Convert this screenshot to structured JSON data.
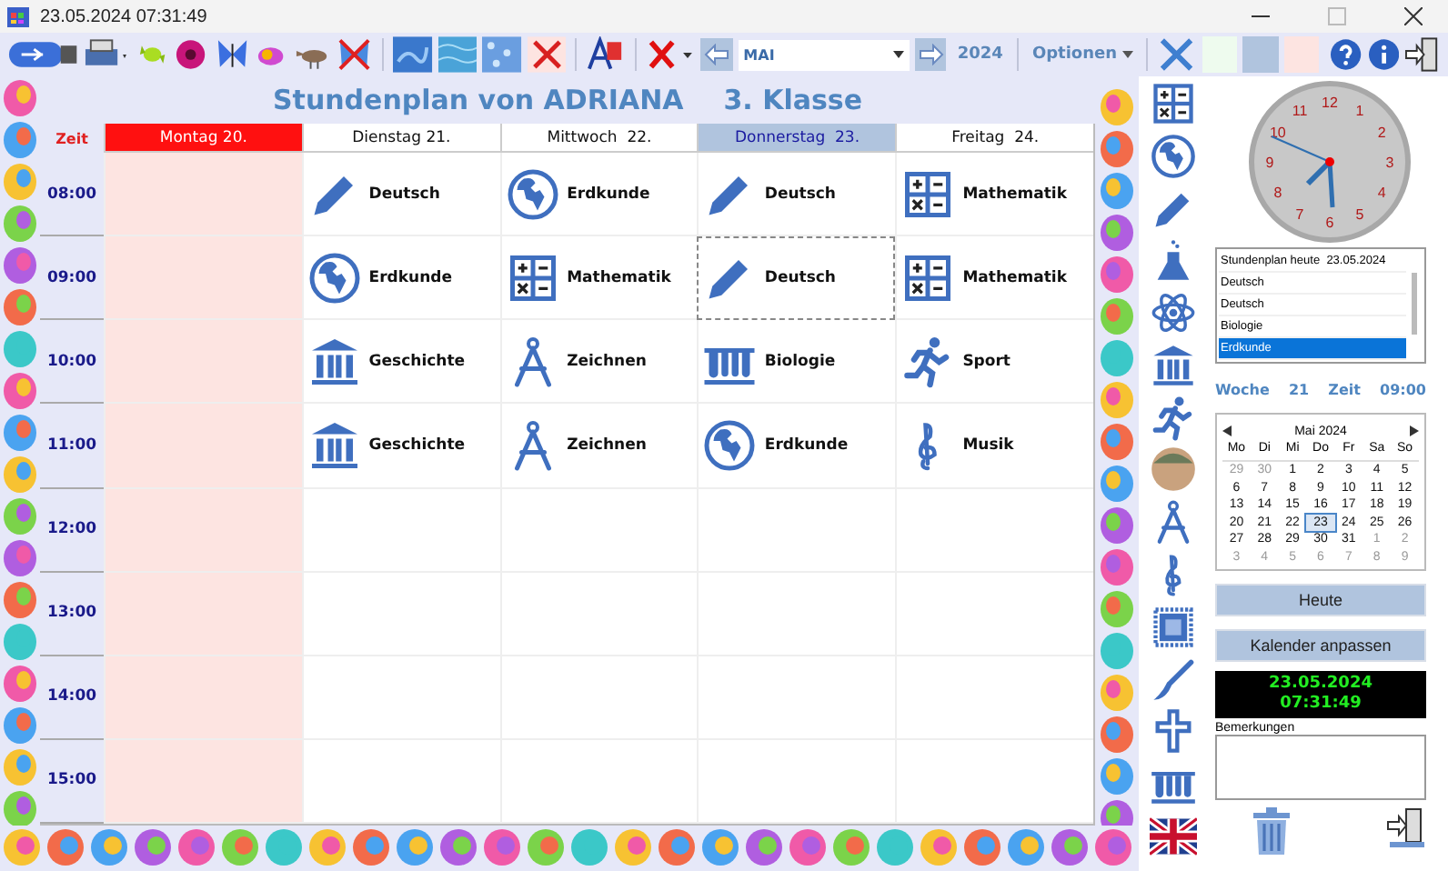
{
  "window": {
    "title": "23.05.2024 07:31:49"
  },
  "toolbar": {
    "month": "MAI",
    "year": "2024",
    "menu": "Optionen",
    "swatches": [
      {
        "color": "#eefbee"
      },
      {
        "color": "#b0c4de"
      },
      {
        "color": "#fde4e1"
      }
    ]
  },
  "timetable": {
    "title": "Stundenplan von ADRIANA",
    "class": "3. Klasse",
    "time_header": "Zeit",
    "days": [
      {
        "label": "Montag 20.",
        "holiday": true,
        "selected": false
      },
      {
        "label": "Dienstag 21.",
        "holiday": false,
        "selected": false
      },
      {
        "label": "Mittwoch  22.",
        "holiday": false,
        "selected": false
      },
      {
        "label": "Donnerstag  23.",
        "holiday": false,
        "selected": true
      },
      {
        "label": "Freitag  24.",
        "holiday": false,
        "selected": false
      }
    ],
    "rows": [
      {
        "time": "08:00",
        "cells": [
          {
            "focused": false
          },
          {
            "subject": "Deutsch",
            "kind": "pencil",
            "focused": false
          },
          {
            "subject": "Erdkunde",
            "kind": "globe",
            "focused": false
          },
          {
            "subject": "Deutsch",
            "kind": "pencil",
            "focused": false
          },
          {
            "subject": "Mathematik",
            "kind": "calculator",
            "focused": false
          }
        ]
      },
      {
        "time": "09:00",
        "cells": [
          {
            "focused": false
          },
          {
            "subject": "Erdkunde",
            "kind": "globe",
            "focused": false
          },
          {
            "subject": "Mathematik",
            "kind": "calculator",
            "focused": false
          },
          {
            "subject": "Deutsch",
            "kind": "pencil",
            "focused": true
          },
          {
            "subject": "Mathematik",
            "kind": "calculator",
            "focused": false
          }
        ]
      },
      {
        "time": "10:00",
        "cells": [
          {
            "focused": false
          },
          {
            "subject": "Geschichte",
            "kind": "building",
            "focused": false
          },
          {
            "subject": "Zeichnen",
            "kind": "compass",
            "focused": false
          },
          {
            "subject": "Biologie",
            "kind": "tubes",
            "focused": false
          },
          {
            "subject": "Sport",
            "kind": "runner",
            "focused": false
          }
        ]
      },
      {
        "time": "11:00",
        "cells": [
          {
            "focused": false
          },
          {
            "subject": "Geschichte",
            "kind": "building",
            "focused": false
          },
          {
            "subject": "Zeichnen",
            "kind": "compass",
            "focused": false
          },
          {
            "subject": "Erdkunde",
            "kind": "globe",
            "focused": false
          },
          {
            "subject": "Musik",
            "kind": "clef",
            "focused": false
          }
        ]
      },
      {
        "time": "12:00",
        "cells": [
          {
            "focused": false
          },
          {
            "focused": false
          },
          {
            "focused": false
          },
          {
            "focused": false
          },
          {
            "focused": false
          }
        ]
      },
      {
        "time": "13:00",
        "cells": [
          {
            "focused": false
          },
          {
            "focused": false
          },
          {
            "focused": false
          },
          {
            "focused": false
          },
          {
            "focused": false
          }
        ]
      },
      {
        "time": "14:00",
        "cells": [
          {
            "focused": false
          },
          {
            "focused": false
          },
          {
            "focused": false
          },
          {
            "focused": false
          },
          {
            "focused": false
          }
        ]
      },
      {
        "time": "15:00",
        "cells": [
          {
            "focused": false
          },
          {
            "focused": false
          },
          {
            "focused": false
          },
          {
            "focused": false
          },
          {
            "focused": false
          }
        ]
      }
    ]
  },
  "clock": {
    "numerals": [
      "12",
      "1",
      "2",
      "3",
      "4",
      "5",
      "6",
      "7",
      "8",
      "9",
      "10",
      "11"
    ]
  },
  "today_list": {
    "header": "Stundenplan heute  23.05.2024",
    "items": [
      {
        "label": "Deutsch",
        "selected": false
      },
      {
        "label": "Deutsch",
        "selected": false
      },
      {
        "label": "Biologie",
        "selected": false
      },
      {
        "label": "Erdkunde",
        "selected": true
      }
    ]
  },
  "week": {
    "label": "Woche",
    "number": "21",
    "time_label": "Zeit",
    "time": "09:00"
  },
  "calendar": {
    "title": "Mai 2024",
    "weekdays": [
      "Mo",
      "Di",
      "Mi",
      "Do",
      "Fr",
      "Sa",
      "So"
    ],
    "weeks": [
      [
        {
          "day": "29",
          "other": true,
          "selected": false
        },
        {
          "day": "30",
          "other": true,
          "selected": false
        },
        {
          "day": "1",
          "other": false,
          "selected": false
        },
        {
          "day": "2",
          "other": false,
          "selected": false
        },
        {
          "day": "3",
          "other": false,
          "selected": false
        },
        {
          "day": "4",
          "other": false,
          "selected": false
        },
        {
          "day": "5",
          "other": false,
          "selected": false
        }
      ],
      [
        {
          "day": "6",
          "other": false,
          "selected": false
        },
        {
          "day": "7",
          "other": false,
          "selected": false
        },
        {
          "day": "8",
          "other": false,
          "selected": false
        },
        {
          "day": "9",
          "other": false,
          "selected": false
        },
        {
          "day": "10",
          "other": false,
          "selected": false
        },
        {
          "day": "11",
          "other": false,
          "selected": false
        },
        {
          "day": "12",
          "other": false,
          "selected": false
        }
      ],
      [
        {
          "day": "13",
          "other": false,
          "selected": false
        },
        {
          "day": "14",
          "other": false,
          "selected": false
        },
        {
          "day": "15",
          "other": false,
          "selected": false
        },
        {
          "day": "16",
          "other": false,
          "selected": false
        },
        {
          "day": "17",
          "other": false,
          "selected": false
        },
        {
          "day": "18",
          "other": false,
          "selected": false
        },
        {
          "day": "19",
          "other": false,
          "selected": false
        }
      ],
      [
        {
          "day": "20",
          "other": false,
          "selected": false
        },
        {
          "day": "21",
          "other": false,
          "selected": false
        },
        {
          "day": "22",
          "other": false,
          "selected": false
        },
        {
          "day": "23",
          "other": false,
          "selected": true
        },
        {
          "day": "24",
          "other": false,
          "selected": false
        },
        {
          "day": "25",
          "other": false,
          "selected": false
        },
        {
          "day": "26",
          "other": false,
          "selected": false
        }
      ],
      [
        {
          "day": "27",
          "other": false,
          "selected": false
        },
        {
          "day": "28",
          "other": false,
          "selected": false
        },
        {
          "day": "29",
          "other": false,
          "selected": false
        },
        {
          "day": "30",
          "other": false,
          "selected": false
        },
        {
          "day": "31",
          "other": false,
          "selected": false
        },
        {
          "day": "1",
          "other": true,
          "selected": false
        },
        {
          "day": "2",
          "other": true,
          "selected": false
        }
      ],
      [
        {
          "day": "3",
          "other": true,
          "selected": false
        },
        {
          "day": "4",
          "other": true,
          "selected": false
        },
        {
          "day": "5",
          "other": true,
          "selected": false
        },
        {
          "day": "6",
          "other": true,
          "selected": false
        },
        {
          "day": "7",
          "other": true,
          "selected": false
        },
        {
          "day": "8",
          "other": true,
          "selected": false
        },
        {
          "day": "9",
          "other": true,
          "selected": false
        }
      ]
    ]
  },
  "buttons": [
    "Heute",
    "Kalender anpassen"
  ],
  "display": {
    "date": "23.05.2024",
    "time": "07:31:49"
  },
  "notes": {
    "label": "Bemerkungen"
  }
}
